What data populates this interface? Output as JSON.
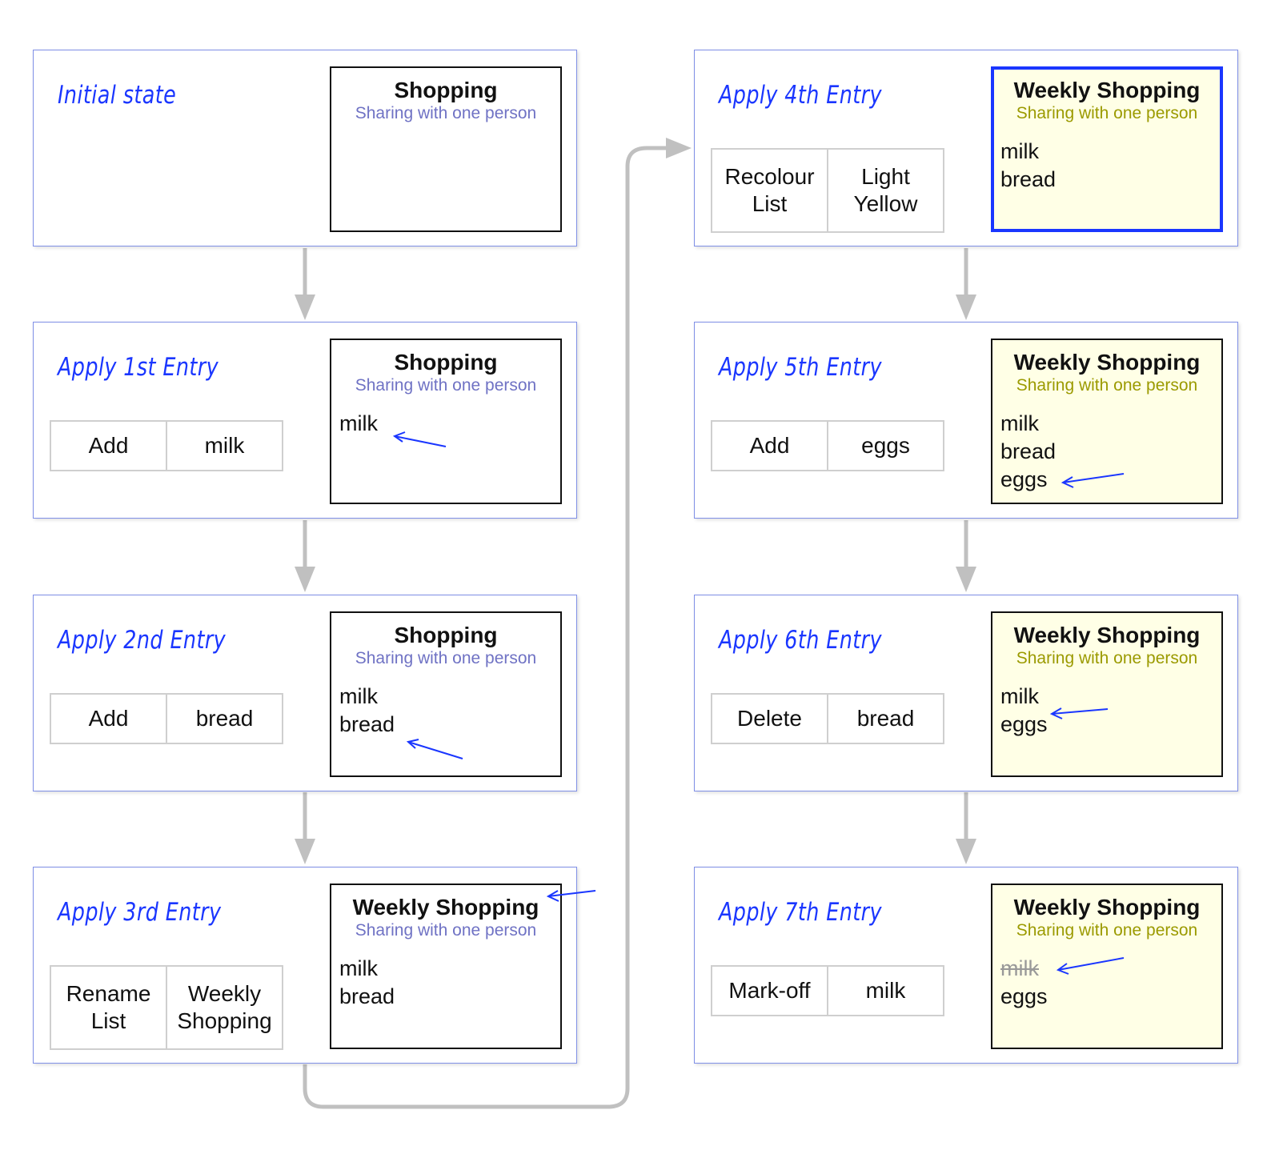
{
  "colors": {
    "accent": "#1a36ff",
    "subtitle_default": "#6f72c4",
    "subtitle_yellow": "#9b9a00",
    "card_yellow": "#ffffe6",
    "connector": "#c0c0c0"
  },
  "steps": [
    {
      "title": "Initial state",
      "entry": null,
      "list": {
        "name": "Shopping",
        "subtitle": "Sharing with one person",
        "items": []
      }
    },
    {
      "title": "Apply 1st Entry",
      "entry": {
        "op": "Add",
        "value": "milk"
      },
      "list": {
        "name": "Shopping",
        "subtitle": "Sharing with one person",
        "items": [
          "milk"
        ]
      }
    },
    {
      "title": "Apply 2nd Entry",
      "entry": {
        "op": "Add",
        "value": "bread"
      },
      "list": {
        "name": "Shopping",
        "subtitle": "Sharing with one person",
        "items": [
          "milk",
          "bread"
        ]
      }
    },
    {
      "title": "Apply 3rd Entry",
      "entry": {
        "op": "Rename List",
        "value": "Weekly Shopping"
      },
      "list": {
        "name": "Weekly Shopping",
        "subtitle": "Sharing with one person",
        "items": [
          "milk",
          "bread"
        ]
      }
    },
    {
      "title": "Apply 4th Entry",
      "entry": {
        "op": "Recolour List",
        "value": "Light Yellow"
      },
      "list": {
        "name": "Weekly Shopping",
        "subtitle": "Sharing with one person",
        "items": [
          "milk",
          "bread"
        ]
      }
    },
    {
      "title": "Apply 5th Entry",
      "entry": {
        "op": "Add",
        "value": "eggs"
      },
      "list": {
        "name": "Weekly Shopping",
        "subtitle": "Sharing with one person",
        "items": [
          "milk",
          "bread",
          "eggs"
        ]
      }
    },
    {
      "title": "Apply 6th Entry",
      "entry": {
        "op": "Delete",
        "value": "bread"
      },
      "list": {
        "name": "Weekly Shopping",
        "subtitle": "Sharing with one person",
        "items": [
          "milk",
          "eggs"
        ]
      }
    },
    {
      "title": "Apply 7th Entry",
      "entry": {
        "op": "Mark-off",
        "value": "milk"
      },
      "list": {
        "name": "Weekly Shopping",
        "subtitle": "Sharing with one person",
        "items": [
          "milk (marked off)",
          "eggs"
        ]
      }
    }
  ],
  "labels": {
    "s0": {
      "title": "Initial state",
      "name": "Shopping",
      "sub": "Sharing with one person"
    },
    "s1": {
      "title": "Apply 1st Entry",
      "op": "Add",
      "val": "milk",
      "name": "Shopping",
      "sub": "Sharing with one person",
      "i0": "milk"
    },
    "s2": {
      "title": "Apply 2nd Entry",
      "op": "Add",
      "val": "bread",
      "name": "Shopping",
      "sub": "Sharing with one person",
      "i0": "milk",
      "i1": "bread"
    },
    "s3": {
      "title": "Apply 3rd Entry",
      "op": "Rename List",
      "val": "Weekly Shopping",
      "name": "Weekly Shopping",
      "sub": "Sharing with one person",
      "i0": "milk",
      "i1": "bread"
    },
    "s4": {
      "title": "Apply 4th Entry",
      "op": "Recolour List",
      "val": "Light Yellow",
      "name": "Weekly Shopping",
      "sub": "Sharing with one person",
      "i0": "milk",
      "i1": "bread"
    },
    "s5": {
      "title": "Apply 5th Entry",
      "op": "Add",
      "val": "eggs",
      "name": "Weekly Shopping",
      "sub": "Sharing with one person",
      "i0": "milk",
      "i1": "bread",
      "i2": "eggs"
    },
    "s6": {
      "title": "Apply 6th Entry",
      "op": "Delete",
      "val": "bread",
      "name": "Weekly Shopping",
      "sub": "Sharing with one person",
      "i0": "milk",
      "i1": "eggs"
    },
    "s7": {
      "title": "Apply 7th Entry",
      "op": "Mark-off",
      "val": "milk",
      "name": "Weekly Shopping",
      "sub": "Sharing with one person",
      "i0": "milk",
      "i1": "eggs"
    }
  }
}
